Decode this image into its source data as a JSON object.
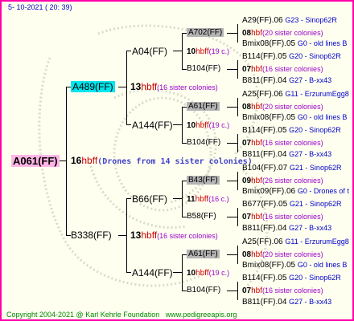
{
  "header": {
    "timestamp": "5- 10-2021 ( 20: 39)"
  },
  "root": {
    "queen": "A061(FF)",
    "num": "16",
    "hb": "hbff",
    "note": "(Drones from 14 sister colonies)"
  },
  "sire_a": {
    "queen": "A489(FF)",
    "num": "13",
    "hb": "hbff",
    "note": "(16 sister colonies)"
  },
  "sire_b": {
    "queen": "B338(FF)",
    "num": "13",
    "hb": "hbff",
    "note": "(16 sister colonies)"
  },
  "g2": [
    {
      "queen": "A04(FF)",
      "num": "10",
      "hb": "hbff",
      "note": "(19 c.)",
      "top": "A702(FF)",
      "bottom": "B104(FF)"
    },
    {
      "queen": "A144(FF)",
      "num": "10",
      "hb": "hbff",
      "note": "(19 c.)",
      "top": "A61(FF)",
      "bottom": "B104(FF)"
    },
    {
      "queen": "B66(FF)",
      "num": "11",
      "hb": "hbff",
      "note": "(16 c.)",
      "top": "B43(FF)",
      "bottom": "B58(FF)"
    },
    {
      "queen": "A144(FF)",
      "num": "10",
      "hb": "hbff",
      "note": "(19 c.)",
      "top": "A61(FF)",
      "bottom": "B104(FF)"
    }
  ],
  "g4": [
    {
      "top": "A29(FF).06",
      "topLine": "G23 - Sinop62R",
      "num": "08",
      "hb": "hbf",
      "note": "(20 sister colonies)",
      "bottom": "Bmix08(FF).05",
      "bottomLine": "G0 - old lines B"
    },
    {
      "top": "B114(FF).05",
      "topLine": "G20 - Sinop62R",
      "num": "07",
      "hb": "hbf",
      "note": "(16 sister colonies)",
      "bottom": "B811(FF).04",
      "bottomLine": "G27 - B-xx43"
    },
    {
      "top": "A25(FF).06",
      "topLine": "G11 - ErzurumEgg8",
      "num": "08",
      "hb": "hbf",
      "note": "(20 sister colonies)",
      "bottom": "Bmix08(FF).05",
      "bottomLine": "G0 - old lines B"
    },
    {
      "top": "B114(FF).05",
      "topLine": "G20 - Sinop62R",
      "num": "07",
      "hb": "hbf",
      "note": "(16 sister colonies)",
      "bottom": "B811(FF).04",
      "bottomLine": "G27 - B-xx43"
    },
    {
      "top": "B104(FF).07",
      "topLine": "G21 - Sinop62R",
      "num": "09",
      "hb": "hbf",
      "note": "(26 sister colonies)",
      "bottom": "Bmix09(FF).06",
      "bottomLine": "G0 - Drones of t"
    },
    {
      "top": "B677(FF).05",
      "topLine": "G21 - Sinop62R",
      "num": "07",
      "hb": "hbf",
      "note": "(16 sister colonies)",
      "bottom": "B811(FF).04",
      "bottomLine": "G27 - B-xx43"
    },
    {
      "top": "A25(FF).06",
      "topLine": "G11 - ErzurumEgg8",
      "num": "08",
      "hb": "hbf",
      "note": "(20 sister colonies)",
      "bottom": "Bmix08(FF).05",
      "bottomLine": "G0 - old lines B"
    },
    {
      "top": "B114(FF).05",
      "topLine": "G20 - Sinop62R",
      "num": "07",
      "hb": "hbf",
      "note": "(16 sister colonies)",
      "bottom": "B811(FF).04",
      "bottomLine": "G27 - B-xx43"
    }
  ],
  "footer": {
    "copyright": "Copyright 2004-2021 @ Karl Kehrle Foundation",
    "site": "www.pedigreeapis.org"
  }
}
